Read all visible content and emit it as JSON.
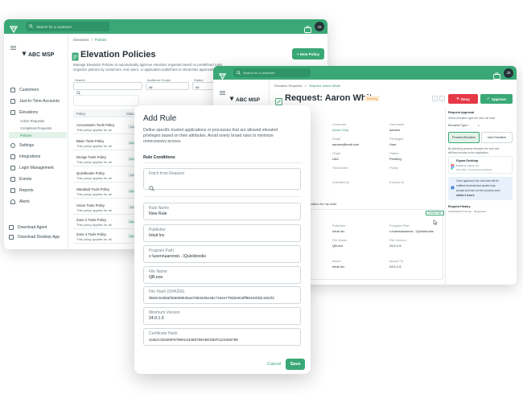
{
  "back_window": {
    "search_placeholder": "Search for a customer",
    "avatar": "JS",
    "breadcrumb": [
      "Elevations",
      "/",
      "Policies"
    ],
    "brand": "ABC MSP",
    "sidebar": [
      {
        "label": "Customers"
      },
      {
        "label": "Just-In-Time-Accounts"
      },
      {
        "label": "Elevations"
      },
      {
        "label": "Active Requests"
      },
      {
        "label": "Completed Requests"
      },
      {
        "label": "Policies"
      },
      {
        "label": "Settings"
      },
      {
        "label": "Integrations"
      },
      {
        "label": "Login Management"
      },
      {
        "label": "Events"
      },
      {
        "label": "Reports"
      },
      {
        "label": "Alerts"
      }
    ],
    "download_agent": "Download Agent",
    "download_desktop": "Download Desktop App",
    "page_title": "Elevation Policies",
    "description_1": "Manage Elevation Policies to automatically approve elevation requests based on predefined rules",
    "description_2": "Organize policies by customers, end users, or application publishers to streamline approvals and",
    "new_policy": "+ New Policy",
    "filters": {
      "search": "Search",
      "audience": "Audience Scope",
      "audience_value": "All",
      "status": "Status",
      "status_value": "All"
    },
    "table_header": {
      "policy": "Policy",
      "status": "Status"
    },
    "policies": [
      {
        "name": "Accountants Tools Policy",
        "desc": "This policy applies for ac",
        "tag": "Draft"
      },
      {
        "name": "Basic Tools Policy",
        "desc": "This policy applies for all",
        "tag": "Active"
      },
      {
        "name": "Design Tools Policy",
        "desc": "This policy applies for de",
        "tag": "Active"
      },
      {
        "name": "Quickbooks Policy",
        "desc": "This policy applies for all",
        "tag": "Draft"
      },
      {
        "name": "Standard Tools Policy",
        "desc": "This policy applies for all",
        "tag": "Active"
      },
      {
        "name": "Union Tools Policy",
        "desc": "This policy applies for de",
        "tag": "Draft"
      },
      {
        "name": "Zone 2 Tools Policy",
        "desc": "This policy applies for all",
        "tag": "Active"
      },
      {
        "name": "Zone 3 Tools Policy",
        "desc": "This policy applies for all",
        "tag": "Active"
      }
    ]
  },
  "request_window": {
    "search_placeholder": "Search for a customer",
    "avatar": "JS",
    "breadcrumb": [
      "Elevation Requests",
      ">",
      "Request: Aaron White"
    ],
    "brand": "ABC MSP",
    "title": "Request: Aaron White",
    "badge": "Pending",
    "deny": "Deny",
    "approve": "Approve",
    "fields": [
      {
        "k": "Customer",
        "v": "Acme Corp"
      },
      {
        "k": "Username",
        "v": "aaronw"
      },
      {
        "k": "Email",
        "v": "aaronw@mail.com"
      },
      {
        "k": "Privileges",
        "v": "User"
      },
      {
        "k": "Origin",
        "v": "UAC"
      },
      {
        "k": "Status",
        "v": "Pending"
      },
      {
        "k": "Technician",
        "v": ""
      },
      {
        "k": "Policy",
        "v": ""
      },
      {
        "k": "Activated At",
        "v": ""
      },
      {
        "k": "Expires At",
        "v": ""
      }
    ],
    "justification": "ication for my work",
    "create_rule": "Create Rule",
    "file_fields": [
      {
        "k": "Publisher",
        "v": "Intuit Inc."
      },
      {
        "k": "Program Path",
        "v": "c:\\users\\aaronw\\...\\Quickbooks"
      },
      {
        "k": "File Name",
        "v": "QB.exe"
      },
      {
        "k": "File Version",
        "v": "24.0.1.5"
      },
      {
        "k": "Issuer",
        "v": "Intuit Inc."
      },
      {
        "k": "Issued To",
        "v": "24.0.1.5"
      }
    ],
    "side": {
      "approval": "Request Approval",
      "approval_desc_1": "Select elevation type the user will have",
      "elevation_type": "Elevation Type *",
      "process": "Process Elevation",
      "user": "User Elevation",
      "note_1": "By selecting process elevation the end user",
      "note_2": "will have access to the application.",
      "app_name": "Figma Desktop",
      "app_pub": "Publisher: Figma, Inc.",
      "app_path": "File origin: C:\\users\\aaronw\\desktop",
      "info_1": "Once approved, the end user will be",
      "info_2": "notified via email and system tray",
      "info_3": "prompt and can run the process once",
      "info_4": "within 4 hours.",
      "history": "Request History",
      "history_row": "12/29/2024 07:43 am · Requested"
    }
  },
  "add_rule": {
    "title": "Add Rule",
    "desc_1": "Define specific trusted applications or processes that are allowed elevated",
    "desc_2": "privileges based on their attributes. Avoid overly broad rules to minimize",
    "desc_3": "unnecessary access.",
    "conditions": "Rule Conditions",
    "fetch_label": "Fetch from Request",
    "fields": [
      {
        "label": "Rule Name",
        "value": "New Rule"
      },
      {
        "label": "Publisher",
        "value": "Intuit Inc"
      },
      {
        "label": "Program Path",
        "value": "c:\\users\\aaronw\\...\\Quickbooks"
      },
      {
        "label": "File Name",
        "value": "QB.exe"
      },
      {
        "label": "File Hash  (SHA256)",
        "value": "0b52c5338af355699530a47683425e48c7344e779d3e815ff9943cbfdc153cf2"
      },
      {
        "label": "Minimum Version",
        "value": "24.0.1.5"
      },
      {
        "label": "Certificate Hash",
        "value": "41B2C3D4E5F67890123456789ABCDEF0123456789"
      }
    ],
    "cancel": "Cancel",
    "save": "Save"
  }
}
